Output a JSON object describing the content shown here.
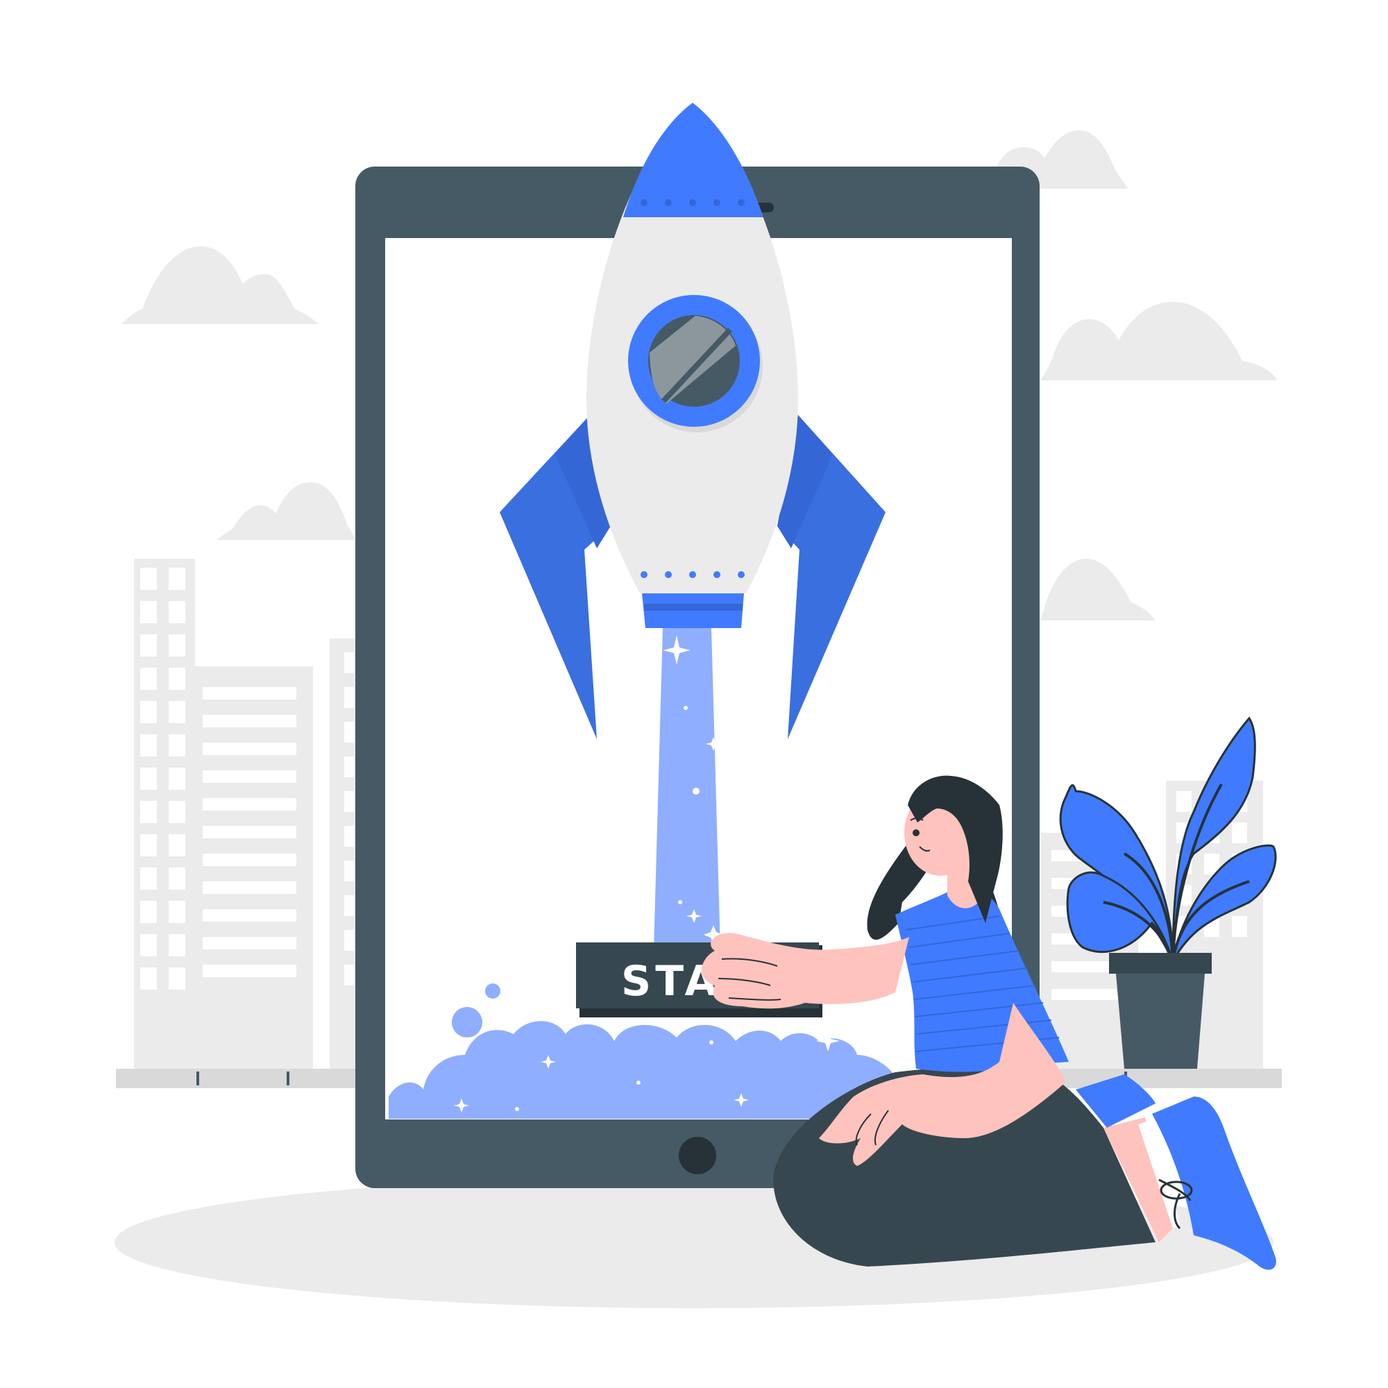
{
  "launch_button": {
    "label": "STAR"
  },
  "colors": {
    "background": "#ffffff",
    "cloud": "#ebebeb",
    "building": "#ebebeb",
    "building_window": "#ffffff",
    "tablet_frame": "#455a64",
    "tablet_screen": "#ffffff",
    "rocket_body": "#ebebeb",
    "rocket_accent": "#407bff",
    "rocket_fin_dark": "#3a6fe0",
    "porthole_glass": "#455a64",
    "porthole_reflection": "#8c979d",
    "exhaust": "#8faeff",
    "button_face": "#37474f",
    "button_text": "#ffffff",
    "skin": "#ffc3bd",
    "hair": "#263238",
    "shirt": "#407bff",
    "pants": "#37474f",
    "shoe": "#407bff",
    "plant_leaf": "#407bff",
    "pot": "#455a64",
    "ground_shadow": "#ebebeb",
    "ledge": "#d9d9d9"
  },
  "icons": [
    "cloud-icon",
    "building-icon",
    "tablet-icon",
    "rocket-icon",
    "sparkle-icon",
    "plant-icon",
    "person-icon"
  ]
}
